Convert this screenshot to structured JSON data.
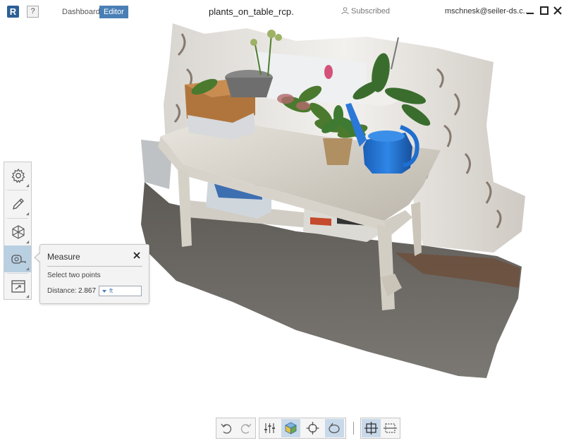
{
  "titlebar": {
    "logo": "R",
    "help": "?",
    "tabs": [
      {
        "label": "Dashboard",
        "active": false
      },
      {
        "label": "Editor",
        "active": true
      }
    ],
    "document_title": "plants_on_table_rcp.",
    "subscription": "Subscribed",
    "user": "mschnesk@seiler-ds.c...",
    "controls": [
      "minimize-icon",
      "maximize-icon",
      "close-icon"
    ]
  },
  "left_toolbar": {
    "tools": [
      {
        "name": "settings",
        "icon": "gear-icon"
      },
      {
        "name": "edit",
        "icon": "pencil-icon"
      },
      {
        "name": "mesh",
        "icon": "hexagon-mesh-icon"
      },
      {
        "name": "measure",
        "icon": "tape-measure-icon",
        "active": true
      },
      {
        "name": "export",
        "icon": "export-icon"
      }
    ]
  },
  "measure_panel": {
    "title": "Measure",
    "hint": "Select two points",
    "distance_label": "Distance:",
    "distance_value": "2.867",
    "unit": "ft"
  },
  "bottom_toolbar": {
    "buttons": [
      {
        "name": "undo",
        "icon": "undo-icon"
      },
      {
        "name": "redo",
        "icon": "redo-icon"
      },
      {
        "name": "adjust",
        "icon": "sliders-icon"
      },
      {
        "name": "view-cube",
        "icon": "cube-icon",
        "active": true
      },
      {
        "name": "target",
        "icon": "crosshair-icon"
      },
      {
        "name": "measure-mode",
        "icon": "tape-icon",
        "active": true
      },
      {
        "name": "fit-view",
        "icon": "fit-frame-icon",
        "active": true
      },
      {
        "name": "region",
        "icon": "region-select-icon"
      }
    ]
  },
  "colors": {
    "accent": "#4a7fb5",
    "logo": "#2c5f95",
    "active_tool": "#b9cfe2",
    "watering_can": "#1f6fd0"
  }
}
